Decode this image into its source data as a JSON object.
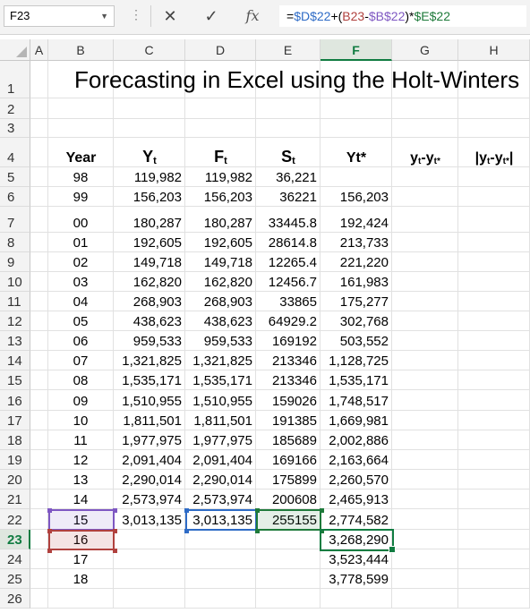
{
  "formula_bar": {
    "name_box": "F23",
    "formula_parts": [
      {
        "text": "=",
        "color": "#000000"
      },
      {
        "text": "$D$22",
        "color": "#2e6bc6"
      },
      {
        "text": "+(",
        "color": "#000000"
      },
      {
        "text": "B23",
        "color": "#b0413e"
      },
      {
        "text": "-",
        "color": "#000000"
      },
      {
        "text": "$B$22",
        "color": "#7e57c2"
      },
      {
        "text": ")*",
        "color": "#000000"
      },
      {
        "text": "$E$22",
        "color": "#1e7a3a"
      }
    ],
    "cancel_icon": "✕",
    "enter_icon": "✓",
    "fx_label": "fx"
  },
  "columns": [
    "A",
    "B",
    "C",
    "D",
    "E",
    "F",
    "G",
    "H"
  ],
  "rows": [
    "1",
    "2",
    "3",
    "4",
    "5",
    "6",
    "7",
    "8",
    "9",
    "10",
    "11",
    "12",
    "13",
    "14",
    "15",
    "16",
    "17",
    "18",
    "19",
    "20",
    "21",
    "22",
    "23",
    "24",
    "25",
    "26"
  ],
  "title": "Forecasting in Excel using the Holt-Winters",
  "headers": {
    "year": "Year",
    "y": "Y",
    "y_sub": "t",
    "f": "F",
    "f_sub": "t",
    "s": "S",
    "s_sub": "t",
    "ystar": "Yt*",
    "g": "y",
    "g_sub": "t",
    "g_mid": "-y",
    "g_sub2": "t",
    "g_sup": "*",
    "h_bar": "|",
    "h": "y",
    "h_sub": "t",
    "h_mid": "-y",
    "h_sub2": "t",
    "h_sup": "*",
    "h_bar2": "|"
  },
  "table": [
    {
      "year": "98",
      "y": "119,982",
      "f": "119,982",
      "s": "36,221",
      "ystar": ""
    },
    {
      "year": "99",
      "y": "156,203",
      "f": "156,203",
      "s": "36221",
      "ystar": "156,203"
    },
    {
      "year": "00",
      "y": "180,287",
      "f": "180,287",
      "s": "33445.8",
      "ystar": "192,424"
    },
    {
      "year": "01",
      "y": "192,605",
      "f": "192,605",
      "s": "28614.8",
      "ystar": "213,733"
    },
    {
      "year": "02",
      "y": "149,718",
      "f": "149,718",
      "s": "12265.4",
      "ystar": "221,220"
    },
    {
      "year": "03",
      "y": "162,820",
      "f": "162,820",
      "s": "12456.7",
      "ystar": "161,983"
    },
    {
      "year": "04",
      "y": "268,903",
      "f": "268,903",
      "s": "33865",
      "ystar": "175,277"
    },
    {
      "year": "05",
      "y": "438,623",
      "f": "438,623",
      "s": "64929.2",
      "ystar": "302,768"
    },
    {
      "year": "06",
      "y": "959,533",
      "f": "959,533",
      "s": "169192",
      "ystar": "503,552"
    },
    {
      "year": "07",
      "y": "1,321,825",
      "f": "1,321,825",
      "s": "213346",
      "ystar": "1,128,725"
    },
    {
      "year": "08",
      "y": "1,535,171",
      "f": "1,535,171",
      "s": "213346",
      "ystar": "1,535,171"
    },
    {
      "year": "09",
      "y": "1,510,955",
      "f": "1,510,955",
      "s": "159026",
      "ystar": "1,748,517"
    },
    {
      "year": "10",
      "y": "1,811,501",
      "f": "1,811,501",
      "s": "191385",
      "ystar": "1,669,981"
    },
    {
      "year": "11",
      "y": "1,977,975",
      "f": "1,977,975",
      "s": "185689",
      "ystar": "2,002,886"
    },
    {
      "year": "12",
      "y": "2,091,404",
      "f": "2,091,404",
      "s": "169166",
      "ystar": "2,163,664"
    },
    {
      "year": "13",
      "y": "2,290,014",
      "f": "2,290,014",
      "s": "175899",
      "ystar": "2,260,570"
    },
    {
      "year": "14",
      "y": "2,573,974",
      "f": "2,573,974",
      "s": "200608",
      "ystar": "2,465,913"
    },
    {
      "year": "15",
      "y": "3,013,135",
      "f": "3,013,135",
      "s": "255155",
      "ystar": "2,774,582"
    },
    {
      "year": "16",
      "y": "",
      "f": "",
      "s": "",
      "ystar": "3,268,290"
    },
    {
      "year": "17",
      "y": "",
      "f": "",
      "s": "",
      "ystar": "3,523,444"
    },
    {
      "year": "18",
      "y": "",
      "f": "",
      "s": "",
      "ystar": "3,778,599"
    }
  ],
  "colors": {
    "selection_green": "#107c41",
    "ref_b22": "#7e57c2",
    "ref_b23": "#b0413e",
    "ref_d22": "#2e6bc6",
    "ref_e22": "#1e7a3a"
  }
}
